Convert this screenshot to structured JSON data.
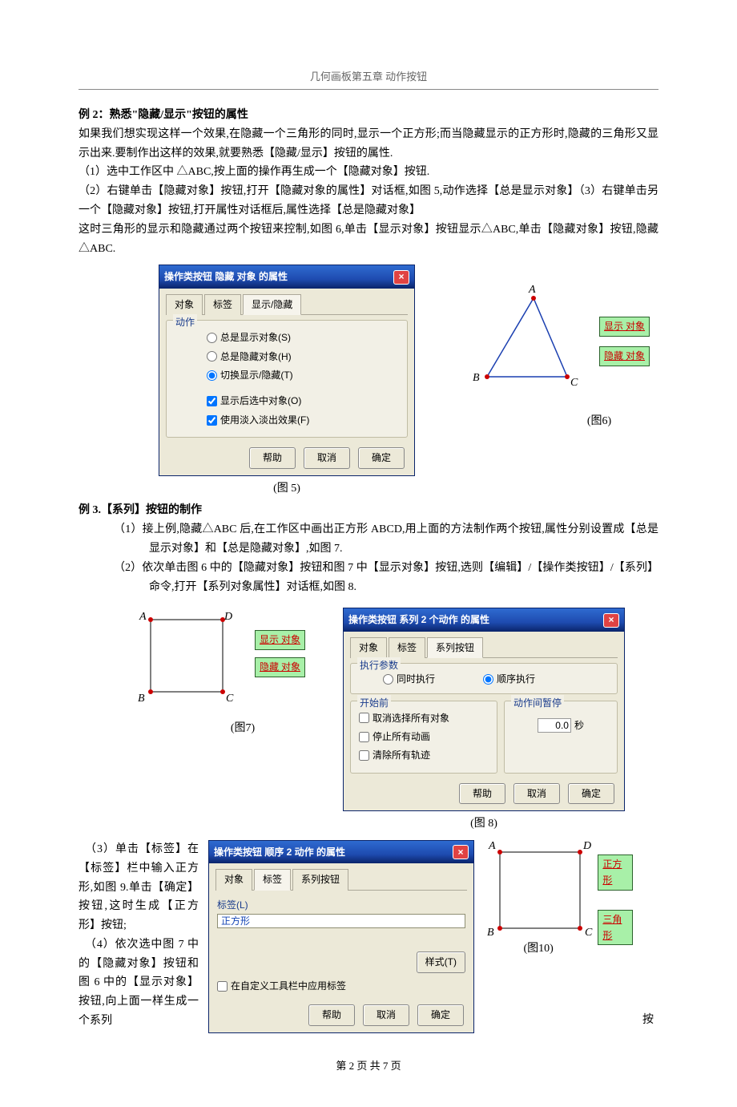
{
  "header": "几何画板第五章 动作按钮",
  "sec2_title": "例 2：熟悉\"隐藏/显示\"按钮的属性",
  "p1": "如果我们想实现这样一个效果,在隐藏一个三角形的同时,显示一个正方形;而当隐藏显示的正方形时,隐藏的三角形又显示出来.要制作出这样的效果,就要熟悉【隐藏/显示】按钮的属性.",
  "p2": "（1）选中工作区中 △ABC,按上面的操作再生成一个【隐藏对象】按钮.",
  "p3": "（2）右键单击【隐藏对象】按钮,打开【隐藏对象的属性】对话框,如图 5,动作选择【总是显示对象】（3）右键单击另一个【隐藏对象】按钮,打开属性对话框后,属性选择【总是隐藏对象】",
  "p4": "这时三角形的显示和隐藏通过两个按钮来控制,如图 6,单击【显示对象】按钮显示△ABC,单击【隐藏对象】按钮,隐藏△ABC.",
  "dlg5": {
    "title": "操作类按钮 隐藏 对象 的属性",
    "tabs": [
      "对象",
      "标签",
      "显示/隐藏"
    ],
    "grp": "动作",
    "r1": "总是显示对象(S)",
    "r2": "总是隐藏对象(H)",
    "r3": "切换显示/隐藏(T)",
    "c1": "显示后选中对象(O)",
    "c2": "使用淡入淡出效果(F)",
    "help": "帮助",
    "cancel": "取消",
    "ok": "确定"
  },
  "fig5cap": "(图 5)",
  "fig6": {
    "A": "A",
    "B": "B",
    "C": "C",
    "show": "显示 对象",
    "hide": "隐藏 对象",
    "cap": "(图6)"
  },
  "sec3_title": "例 3.【系列】按钮的制作",
  "s3_1": "（1）接上例,隐藏△ABC 后,在工作区中画出正方形 ABCD,用上面的方法制作两个按钮,属性分别设置成【总是显示对象】和【总是隐藏对象】,如图 7.",
  "s3_2": "（2）依次单击图 6 中的【隐藏对象】按钮和图 7 中【显示对象】按钮,选则【编辑】/【操作类按钮】/【系列】命令,打开【系列对象属性】对话框,如图 8.",
  "fig7": {
    "A": "A",
    "B": "B",
    "C": "C",
    "D": "D",
    "show": "显示 对象",
    "hide": "隐藏 对象",
    "cap": "(图7)"
  },
  "dlg8": {
    "title": "操作类按钮 系列 2 个动作 的属性",
    "tabs": [
      "对象",
      "标签",
      "系列按钮"
    ],
    "grp1": "执行参数",
    "r1": "同时执行",
    "r2": "顺序执行",
    "grp2": "开始前",
    "c1": "取消选择所有对象",
    "c2": "停止所有动画",
    "c3": "清除所有轨迹",
    "grp3": "动作间暂停",
    "sec_val": "0.0",
    "sec": "秒",
    "help": "帮助",
    "cancel": "取消",
    "ok": "确定"
  },
  "fig8cap": "(图 8)",
  "s3_3a": "　（3）单击【标签】在【标签】栏中输入正方形,如图 9.单击【确定】按钮,这时生成【正方形】按钮;",
  "s3_4a": "　（4）依次选中图 7 中的【隐藏对象】按钮和图 6 中的【显示对象】按钮,向上面一样生成一个系列",
  "s3_4tail": "按",
  "dlg9": {
    "title": "操作类按钮 顺序 2 动作 的属性",
    "tabs": [
      "对象",
      "标签",
      "系列按钮"
    ],
    "lbl": "标签(L)",
    "val": "正方形",
    "style": "样式(T)",
    "chk": "在自定义工具栏中应用标签",
    "help": "帮助",
    "cancel": "取消",
    "ok": "确定"
  },
  "fig10": {
    "A": "A",
    "B": "B",
    "C": "C",
    "D": "D",
    "sq": "正方形",
    "tri": "三角形",
    "cap": "(图10)"
  },
  "footer": "第 2 页 共 7 页"
}
